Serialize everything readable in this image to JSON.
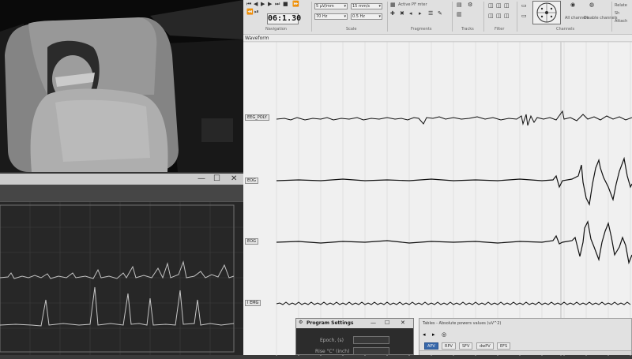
{
  "camera": {
    "name": "patient-video-feed"
  },
  "mini_window": {
    "controls": [
      "—",
      "☐",
      "✕"
    ]
  },
  "ribbon": {
    "time_counter": "06:1.30",
    "groups": [
      "Navigation",
      "Scale",
      "Fragments",
      "Tracks",
      "Filter",
      "Channels"
    ],
    "scale_combos": [
      "5 µV/mm",
      "15 mm/s",
      "70 Hz",
      "0.5 Hz"
    ],
    "fragment_label": "Active PF mter",
    "channels_buttons": [
      "All channels",
      "Disable channels"
    ],
    "right_items": [
      "Relate",
      "Sh",
      "Attach"
    ]
  },
  "waveform": {
    "title": "Waveform",
    "channels": [
      "EEG_POLY",
      "EOG",
      "EOG",
      "I EMG"
    ]
  },
  "dialog": {
    "title": "Program Settings",
    "fields": [
      {
        "label": "Epoch, (s)",
        "value": ""
      },
      {
        "label": "Rise \"C\" (inch)",
        "value": ""
      }
    ]
  },
  "tables": {
    "title": "Tables - Absolute powers values (uV^2)",
    "tabs": [
      "APV",
      "RPV",
      "SFV",
      "dwPV",
      "EFS"
    ],
    "active_tab": 0
  }
}
